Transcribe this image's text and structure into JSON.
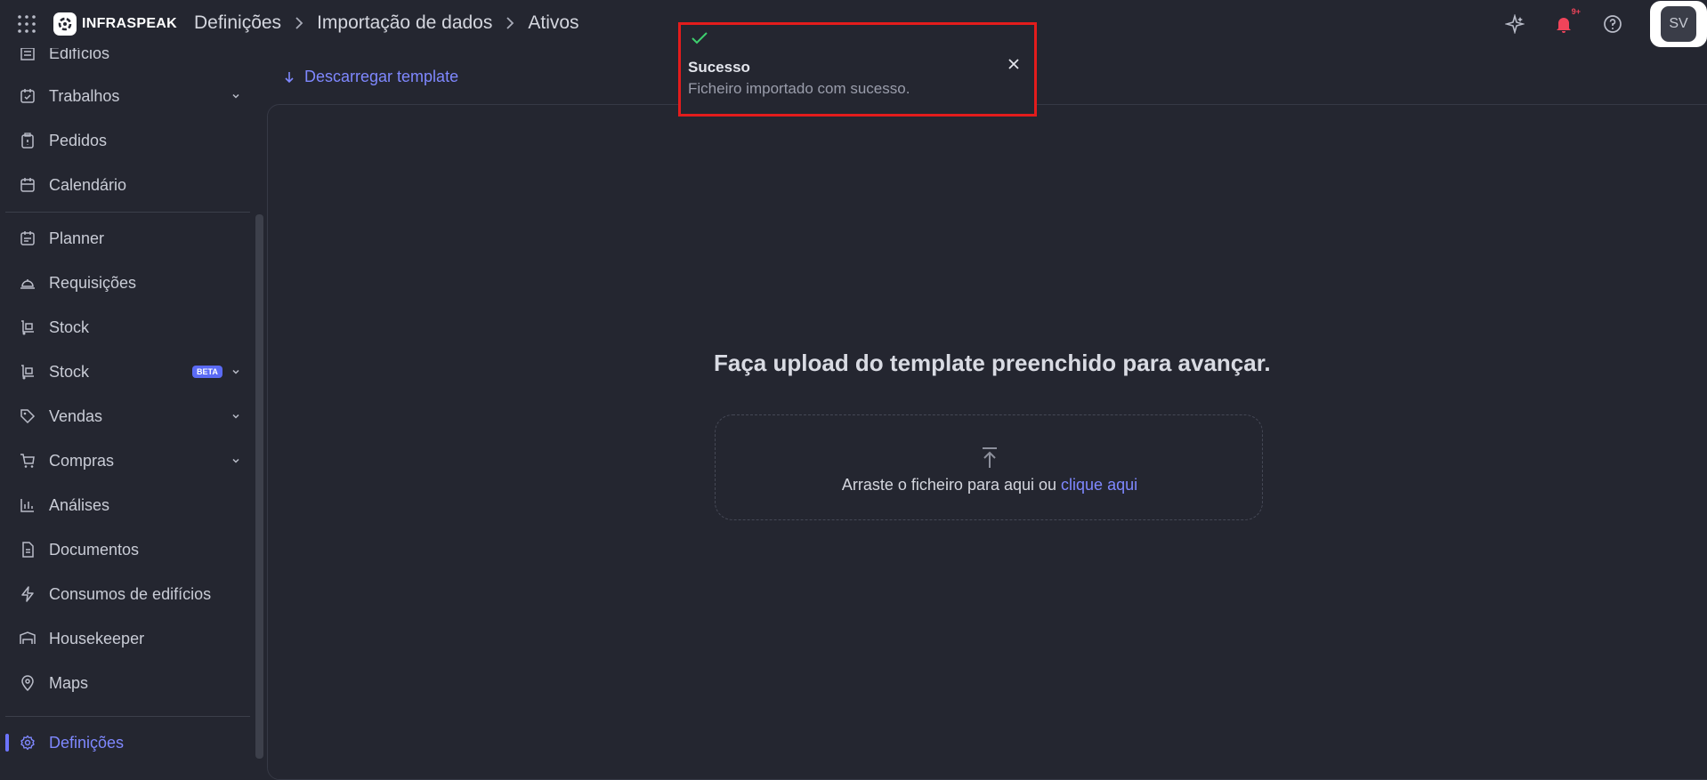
{
  "header": {
    "logo_text": "INFRASPEAK",
    "breadcrumb": [
      "Definições",
      "Importação de dados",
      "Ativos"
    ],
    "notification_count": "9+",
    "avatar_initials": "SV"
  },
  "sidebar": {
    "items": [
      {
        "label": "Edifícios",
        "icon": "building-icon"
      },
      {
        "label": "Trabalhos",
        "icon": "calendar-check-icon",
        "expandable": true
      },
      {
        "label": "Pedidos",
        "icon": "clipboard-icon"
      },
      {
        "label": "Calendário",
        "icon": "calendar-icon"
      },
      {
        "label": "Planner",
        "icon": "planner-icon"
      },
      {
        "label": "Requisições",
        "icon": "bell-service-icon"
      },
      {
        "label": "Stock",
        "icon": "dolly-icon"
      },
      {
        "label": "Stock",
        "icon": "dolly-icon",
        "badge": "BETA",
        "expandable": true
      },
      {
        "label": "Vendas",
        "icon": "tag-icon",
        "expandable": true
      },
      {
        "label": "Compras",
        "icon": "cart-icon",
        "expandable": true
      },
      {
        "label": "Análises",
        "icon": "bar-chart-icon"
      },
      {
        "label": "Documentos",
        "icon": "document-icon"
      },
      {
        "label": "Consumos de edifícios",
        "icon": "lightning-icon"
      },
      {
        "label": "Housekeeper",
        "icon": "bed-icon"
      },
      {
        "label": "Maps",
        "icon": "map-pin-icon"
      },
      {
        "label": "Definições",
        "icon": "gear-icon",
        "active": true
      }
    ]
  },
  "main": {
    "download_label": "Descarregar template",
    "upload_title": "Faça upload do template preenchido para avançar.",
    "drop_text": "Arraste o ficheiro para aqui ou ",
    "drop_link": "clique aqui"
  },
  "toast": {
    "title": "Sucesso",
    "message": "Ficheiro importado com sucesso."
  },
  "colors": {
    "accent": "#7f88ff",
    "background": "#242630",
    "success": "#3ecf6e",
    "highlight_border": "#e31c1c"
  }
}
